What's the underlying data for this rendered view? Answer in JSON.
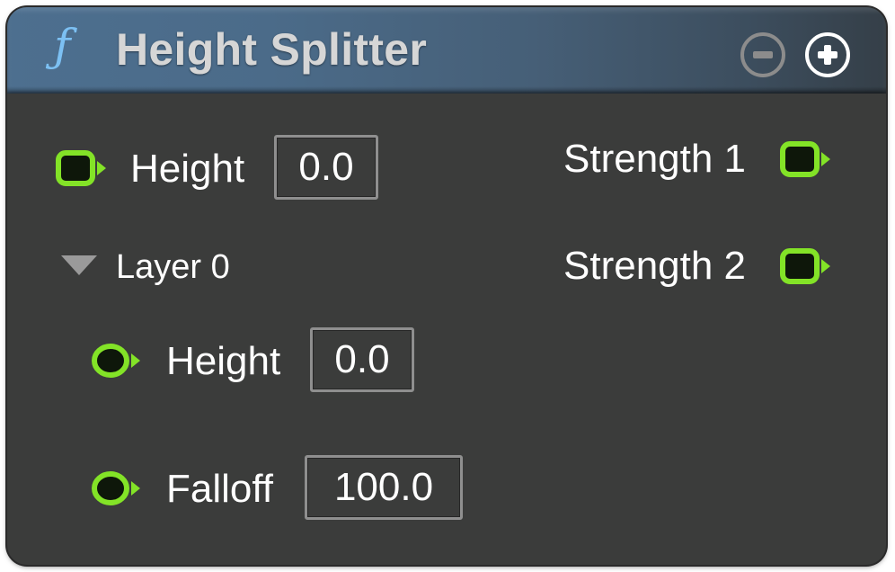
{
  "node": {
    "title": "Height Splitter",
    "function_icon": "ƒ",
    "header_buttons": [
      {
        "name": "collapse-pins-button",
        "icon": "minus-circle-icon",
        "state": "disabled"
      },
      {
        "name": "add-pin-button",
        "icon": "plus-circle-icon",
        "state": "enabled"
      }
    ]
  },
  "inputs": {
    "height": {
      "label": "Height",
      "value": "0.0",
      "pin": "square-pin-icon"
    },
    "layer": {
      "label": "Layer 0",
      "expanded": true,
      "fields": [
        {
          "label": "Height",
          "value": "0.0",
          "pin": "round-pin-icon"
        },
        {
          "label": "Falloff",
          "value": "100.0",
          "pin": "round-pin-icon"
        }
      ]
    }
  },
  "outputs": [
    {
      "label": "Strength 1",
      "pin": "square-pin-icon"
    },
    {
      "label": "Strength 2",
      "pin": "square-pin-icon"
    }
  ],
  "colors": {
    "pin_green": "#83e327",
    "pin_fill": "#0e170a",
    "header_blue": "#4d6f8f",
    "function_icon": "#7cc0f3",
    "node_body": "#3b3c3b"
  }
}
